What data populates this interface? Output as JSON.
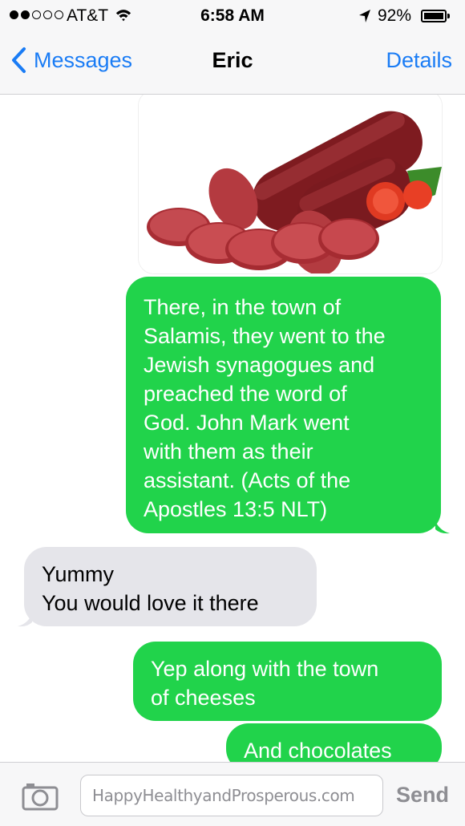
{
  "status": {
    "carrier": "AT&T",
    "time": "6:58 AM",
    "battery_percent": "92%",
    "signal_bars_filled": 2,
    "signal_bars_total": 5
  },
  "nav": {
    "back_label": "Messages",
    "title": "Eric",
    "details_label": "Details"
  },
  "conversation": {
    "image": {
      "description_icon": "salami-photo"
    },
    "messages": [
      {
        "direction": "outgoing",
        "lines": [
          "There, in the town of",
          "Salamis, they went to the",
          "Jewish synagogues and",
          "preached the word of",
          "God. John Mark went",
          "with them as their",
          "assistant. (Acts of the",
          "Apostles 13:5 NLT)"
        ]
      },
      {
        "direction": "incoming",
        "lines": [
          "Yummy",
          "You would love it there"
        ]
      },
      {
        "direction": "outgoing",
        "lines": [
          "Yep along with the town",
          "of cheeses"
        ]
      },
      {
        "direction": "outgoing",
        "lines": [
          "And chocolates"
        ]
      }
    ]
  },
  "composer": {
    "input_value": "HappyHealthyandProsperous.com",
    "send_label": "Send",
    "camera_icon": "camera-icon"
  },
  "colors": {
    "ios_blue": "#1a7cf5",
    "outgoing_bubble": "#21d34b",
    "incoming_bubble": "#e5e5ea"
  }
}
